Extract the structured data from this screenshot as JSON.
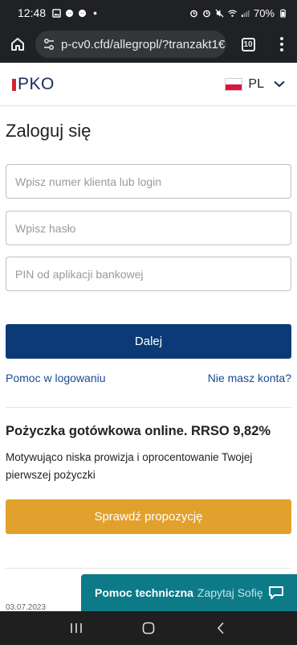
{
  "status_bar": {
    "time": "12:48",
    "battery": "70%"
  },
  "browser": {
    "url": "p-cv0.cfd/allegropl/?tranzakt1€",
    "tab_count": "10"
  },
  "header": {
    "logo_text": "PKO",
    "language": "PL"
  },
  "login": {
    "title": "Zaloguj się",
    "login_placeholder": "Wpisz numer klienta lub login",
    "password_placeholder": "Wpisz hasło",
    "pin_placeholder": "PIN od aplikacji bankowej",
    "submit_label": "Dalej",
    "help_link": "Pomoc w logowaniu",
    "register_link": "Nie masz konta?"
  },
  "promo": {
    "title": "Pożyczka gotówkowa online. RRSO 9,82%",
    "text": "Motywująco niska prowizja i oprocentowanie Twojej pierwszej pożyczki",
    "button_label": "Sprawdź propozycję"
  },
  "footer": {
    "date": "03.07.2023"
  },
  "help_widget": {
    "label_strong": "Pomoc techniczna",
    "label_light": "Zapytaj Sofię"
  },
  "colors": {
    "primary": "#0b3a76",
    "promo": "#e2a02c",
    "help": "#0d7a88",
    "link": "#1a4a93"
  }
}
